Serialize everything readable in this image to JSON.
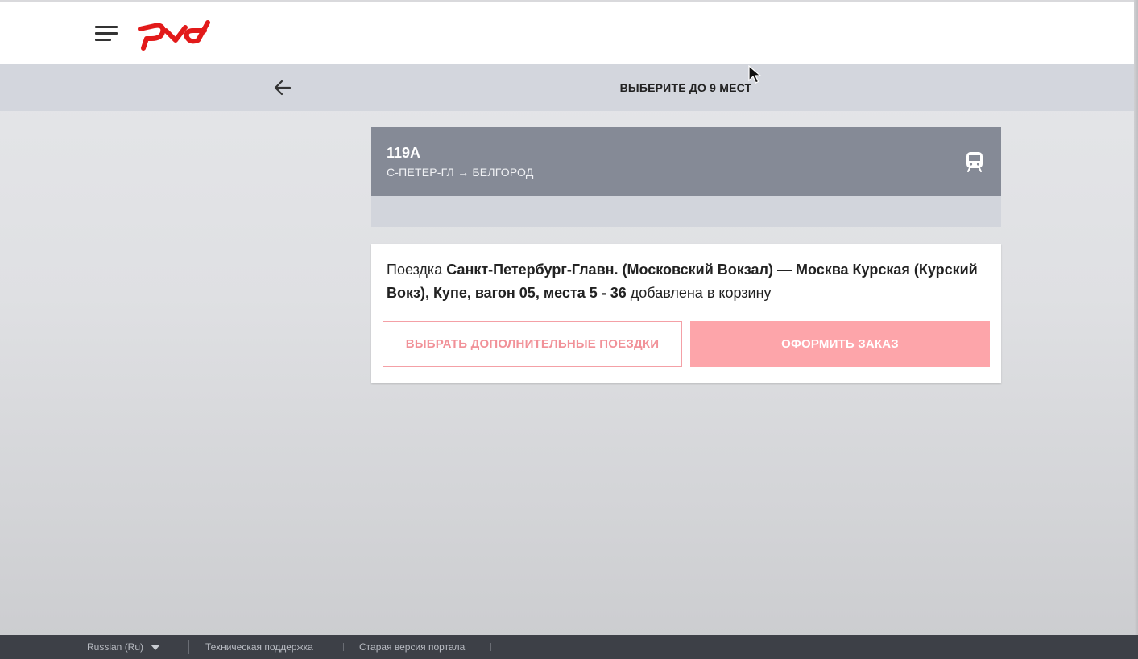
{
  "header": {
    "menu_icon": "hamburger-menu-icon",
    "logo_text": "РЖД",
    "brand_color": "#e21a1a"
  },
  "subheader": {
    "back_icon": "arrow-left-icon",
    "title": "ВЫБЕРИТЕ ДО 9 МЕСТ"
  },
  "train": {
    "number": "119А",
    "route": "С-ПЕТЕР-ГЛ → БЕЛГОРОД",
    "icon": "train-icon"
  },
  "confirmation": {
    "prefix": "Поездка ",
    "trip_bold": "Санкт-Петербург-Главн. (Московский Вокзал) — Москва Курская (Курский Вокз), Купе, вагон 05, места 5 - 36",
    "suffix": " добавлена в корзину"
  },
  "actions": {
    "secondary_label": "ВЫБРАТЬ ДОПОЛНИТЕЛЬНЫЕ ПОЕЗДКИ",
    "primary_label": "ОФОРМИТЬ ЗАКАЗ",
    "accent_color": "#fda5aa"
  },
  "footer": {
    "language": "Russian  (Ru)",
    "support_link": "Техническая поддержка",
    "old_version_link": "Старая версия портала"
  }
}
